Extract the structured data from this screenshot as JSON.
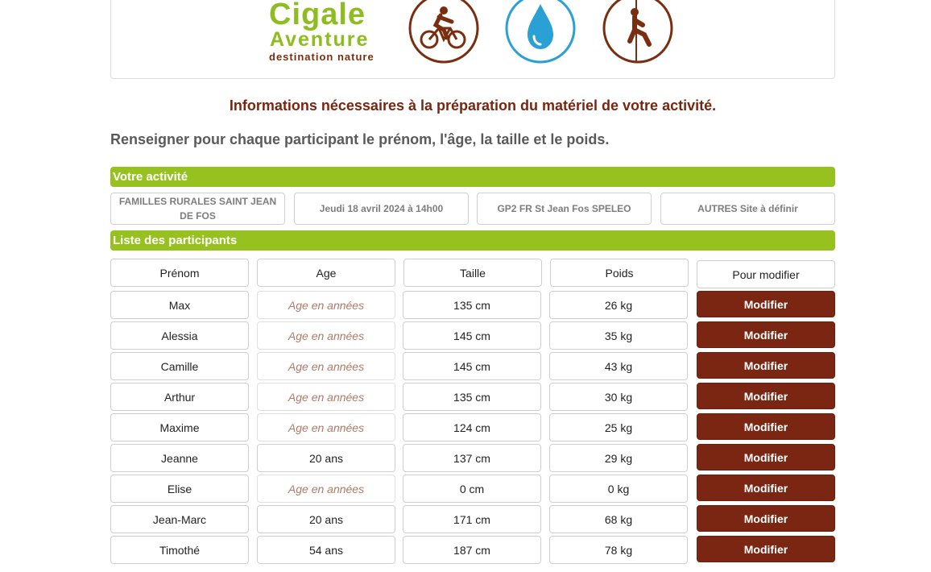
{
  "logo": {
    "line1": "Cigale",
    "line2": "Aventure",
    "line3": "destination nature",
    "icons": [
      "cyclist-icon",
      "water-drop-icon",
      "rappel-climber-icon"
    ],
    "colors": {
      "green": "#8dbd1f",
      "brown": "#7a2e10",
      "blue": "#2aa0d4"
    }
  },
  "info_text": "Informations nécessaires à la préparation du matériel de votre activité.",
  "instruction_text": "Renseigner pour chaque participant le prénom, l'âge, la taille et le poids.",
  "activity": {
    "title": "Votre activité",
    "cells": [
      "FAMILLES RURALES SAINT JEAN DE FOS",
      "Jeudi 18 avril 2024 à 14h00",
      "GP2 FR St Jean Fos SPELEO",
      "AUTRES Site à définir"
    ]
  },
  "participants": {
    "title": "Liste des participants",
    "headers": {
      "prenom": "Prénom",
      "age": "Age",
      "taille": "Taille",
      "poids": "Poids",
      "modifier": "Pour modifier"
    },
    "age_placeholder": "Age en années",
    "button_label": "Modifier",
    "rows": [
      {
        "prenom": "Max",
        "age": "",
        "taille": "135 cm",
        "poids": "26 kg"
      },
      {
        "prenom": "Alessia",
        "age": "",
        "taille": "145 cm",
        "poids": "35 kg"
      },
      {
        "prenom": "Camille",
        "age": "",
        "taille": "145 cm",
        "poids": "43 kg"
      },
      {
        "prenom": "Arthur",
        "age": "",
        "taille": "135 cm",
        "poids": "30 kg"
      },
      {
        "prenom": "Maxime",
        "age": "",
        "taille": "124 cm",
        "poids": "25 kg"
      },
      {
        "prenom": "Jeanne",
        "age": "20 ans",
        "taille": "137 cm",
        "poids": "29 kg"
      },
      {
        "prenom": "Elise",
        "age": "",
        "taille": "0 cm",
        "poids": "0 kg"
      },
      {
        "prenom": "Jean-Marc",
        "age": "20 ans",
        "taille": "171 cm",
        "poids": "68 kg"
      },
      {
        "prenom": "Timothé",
        "age": "54 ans",
        "taille": "187 cm",
        "poids": "78 kg"
      }
    ]
  },
  "colors": {
    "section_bar": "#96c11f",
    "button": "#7b2613",
    "info_text": "#7a2510",
    "placeholder": "#b07a66"
  }
}
